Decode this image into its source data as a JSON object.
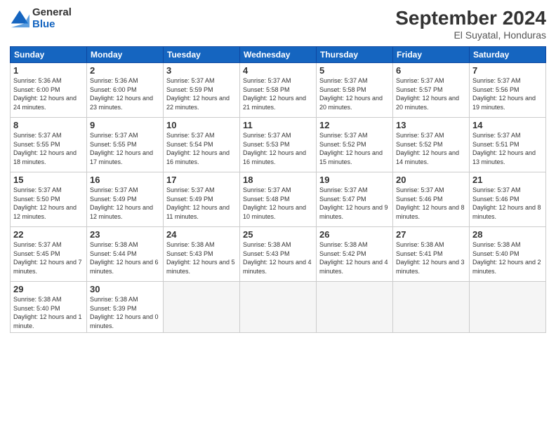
{
  "header": {
    "logo_general": "General",
    "logo_blue": "Blue",
    "month_title": "September 2024",
    "location": "El Suyatal, Honduras"
  },
  "days_of_week": [
    "Sunday",
    "Monday",
    "Tuesday",
    "Wednesday",
    "Thursday",
    "Friday",
    "Saturday"
  ],
  "weeks": [
    [
      {
        "day": "1",
        "rise": "5:36 AM",
        "set": "6:00 PM",
        "daylight": "12 hours and 24 minutes."
      },
      {
        "day": "2",
        "rise": "5:36 AM",
        "set": "6:00 PM",
        "daylight": "12 hours and 23 minutes."
      },
      {
        "day": "3",
        "rise": "5:37 AM",
        "set": "5:59 PM",
        "daylight": "12 hours and 22 minutes."
      },
      {
        "day": "4",
        "rise": "5:37 AM",
        "set": "5:58 PM",
        "daylight": "12 hours and 21 minutes."
      },
      {
        "day": "5",
        "rise": "5:37 AM",
        "set": "5:58 PM",
        "daylight": "12 hours and 20 minutes."
      },
      {
        "day": "6",
        "rise": "5:37 AM",
        "set": "5:57 PM",
        "daylight": "12 hours and 20 minutes."
      },
      {
        "day": "7",
        "rise": "5:37 AM",
        "set": "5:56 PM",
        "daylight": "12 hours and 19 minutes."
      }
    ],
    [
      {
        "day": "8",
        "rise": "5:37 AM",
        "set": "5:55 PM",
        "daylight": "12 hours and 18 minutes."
      },
      {
        "day": "9",
        "rise": "5:37 AM",
        "set": "5:55 PM",
        "daylight": "12 hours and 17 minutes."
      },
      {
        "day": "10",
        "rise": "5:37 AM",
        "set": "5:54 PM",
        "daylight": "12 hours and 16 minutes."
      },
      {
        "day": "11",
        "rise": "5:37 AM",
        "set": "5:53 PM",
        "daylight": "12 hours and 16 minutes."
      },
      {
        "day": "12",
        "rise": "5:37 AM",
        "set": "5:52 PM",
        "daylight": "12 hours and 15 minutes."
      },
      {
        "day": "13",
        "rise": "5:37 AM",
        "set": "5:52 PM",
        "daylight": "12 hours and 14 minutes."
      },
      {
        "day": "14",
        "rise": "5:37 AM",
        "set": "5:51 PM",
        "daylight": "12 hours and 13 minutes."
      }
    ],
    [
      {
        "day": "15",
        "rise": "5:37 AM",
        "set": "5:50 PM",
        "daylight": "12 hours and 12 minutes."
      },
      {
        "day": "16",
        "rise": "5:37 AM",
        "set": "5:49 PM",
        "daylight": "12 hours and 12 minutes."
      },
      {
        "day": "17",
        "rise": "5:37 AM",
        "set": "5:49 PM",
        "daylight": "12 hours and 11 minutes."
      },
      {
        "day": "18",
        "rise": "5:37 AM",
        "set": "5:48 PM",
        "daylight": "12 hours and 10 minutes."
      },
      {
        "day": "19",
        "rise": "5:37 AM",
        "set": "5:47 PM",
        "daylight": "12 hours and 9 minutes."
      },
      {
        "day": "20",
        "rise": "5:37 AM",
        "set": "5:46 PM",
        "daylight": "12 hours and 8 minutes."
      },
      {
        "day": "21",
        "rise": "5:37 AM",
        "set": "5:46 PM",
        "daylight": "12 hours and 8 minutes."
      }
    ],
    [
      {
        "day": "22",
        "rise": "5:37 AM",
        "set": "5:45 PM",
        "daylight": "12 hours and 7 minutes."
      },
      {
        "day": "23",
        "rise": "5:38 AM",
        "set": "5:44 PM",
        "daylight": "12 hours and 6 minutes."
      },
      {
        "day": "24",
        "rise": "5:38 AM",
        "set": "5:43 PM",
        "daylight": "12 hours and 5 minutes."
      },
      {
        "day": "25",
        "rise": "5:38 AM",
        "set": "5:43 PM",
        "daylight": "12 hours and 4 minutes."
      },
      {
        "day": "26",
        "rise": "5:38 AM",
        "set": "5:42 PM",
        "daylight": "12 hours and 4 minutes."
      },
      {
        "day": "27",
        "rise": "5:38 AM",
        "set": "5:41 PM",
        "daylight": "12 hours and 3 minutes."
      },
      {
        "day": "28",
        "rise": "5:38 AM",
        "set": "5:40 PM",
        "daylight": "12 hours and 2 minutes."
      }
    ],
    [
      {
        "day": "29",
        "rise": "5:38 AM",
        "set": "5:40 PM",
        "daylight": "12 hours and 1 minute."
      },
      {
        "day": "30",
        "rise": "5:38 AM",
        "set": "5:39 PM",
        "daylight": "12 hours and 0 minutes."
      },
      null,
      null,
      null,
      null,
      null
    ]
  ]
}
